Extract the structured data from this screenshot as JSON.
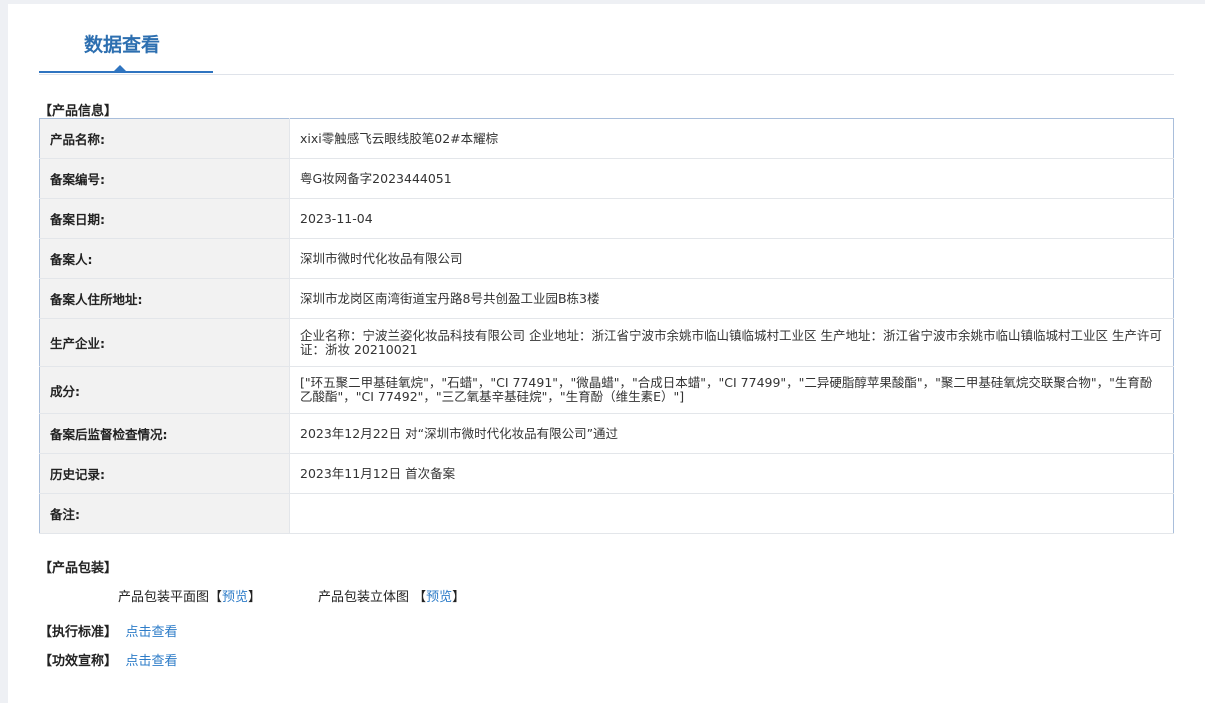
{
  "tab": {
    "title": "数据查看"
  },
  "product_info": {
    "heading": "【产品信息】",
    "rows": [
      {
        "label": "产品名称:",
        "value": "xixi零触感飞云眼线胶笔02#本耀棕"
      },
      {
        "label": "备案编号:",
        "value": "粤G妆网备字2023444051"
      },
      {
        "label": "备案日期:",
        "value": "2023-11-04"
      },
      {
        "label": "备案人:",
        "value": "深圳市微时代化妆品有限公司"
      },
      {
        "label": "备案人住所地址:",
        "value": "深圳市龙岗区南湾街道宝丹路8号共创盈工业园B栋3楼"
      },
      {
        "label": "生产企业:",
        "value": "企业名称：宁波兰姿化妆品科技有限公司 企业地址：浙江省宁波市余姚市临山镇临城村工业区 生产地址：浙江省宁波市余姚市临山镇临城村工业区 生产许可证：浙妆 20210021"
      },
      {
        "label": "成分:",
        "value": "[\"环五聚二甲基硅氧烷\"，\"石蜡\"，\"CI 77491\"，\"微晶蜡\"，\"合成日本蜡\"，\"CI 77499\"，\"二异硬脂醇苹果酸酯\"，\"聚二甲基硅氧烷交联聚合物\"，\"生育酚乙酸酯\"，\"CI 77492\"，\"三乙氧基辛基硅烷\"，\"生育酚（维生素E）\"]"
      },
      {
        "label": "备案后监督检查情况:",
        "value": "2023年12月22日 对“深圳市微时代化妆品有限公司”通过"
      },
      {
        "label": "历史记录:",
        "value": "2023年11月12日 首次备案"
      },
      {
        "label": "备注:",
        "value": ""
      }
    ]
  },
  "packaging": {
    "heading": "【产品包装】",
    "flat_label": "产品包装平面图",
    "flat_link": "预览",
    "solid_label": "产品包装立体图",
    "solid_link": "预览"
  },
  "standard": {
    "heading": "【执行标准】",
    "link": "点击查看"
  },
  "efficacy": {
    "heading": "【功效宣称】",
    "link": "点击查看"
  }
}
